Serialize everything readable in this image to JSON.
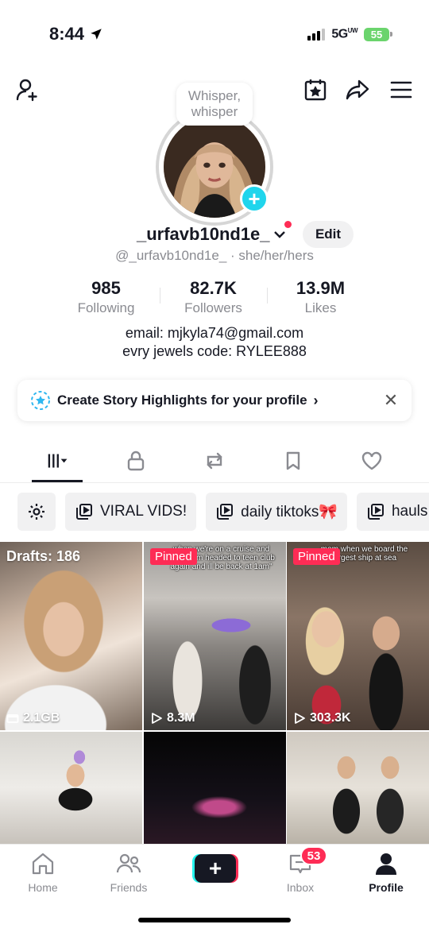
{
  "status_bar": {
    "time": "8:44",
    "network": "5G",
    "network_suffix": "UW",
    "battery": "55"
  },
  "profile": {
    "bubble_text": "Whisper, whisper",
    "username": "_urfavb10nd1e_",
    "edit_label": "Edit",
    "handle": "@_urfavb10nd1e_ · she/her/hers",
    "stats": [
      {
        "value": "985",
        "label": "Following"
      },
      {
        "value": "82.7K",
        "label": "Followers"
      },
      {
        "value": "13.9M",
        "label": "Likes"
      }
    ],
    "bio_line1": "email: mjkyla74@gmail.com",
    "bio_line2": "evry jewels code: RYLEE888"
  },
  "story_banner": {
    "text": "Create Story Highlights for your profile",
    "chevron": "›",
    "close": "✕"
  },
  "tabs": [
    {
      "icon": "videos-grid-icon",
      "active": true
    },
    {
      "icon": "lock-icon",
      "active": false
    },
    {
      "icon": "repost-icon",
      "active": false
    },
    {
      "icon": "bookmark-icon",
      "active": false
    },
    {
      "icon": "heart-icon",
      "active": false
    }
  ],
  "chips": {
    "items": [
      "VIRAL VIDS!",
      "daily tiktoks🎀",
      "hauls"
    ]
  },
  "videos": [
    {
      "overlay": "Drafts: 186",
      "stat": "2.1GB",
      "stat_icon": "folder-icon"
    },
    {
      "overlay": "Pinned",
      "caption": "when we're on a cruise and them: \"I'm headed to teen club again and ill be back at 1am\"",
      "stat": "8.3M",
      "stat_icon": "play-icon"
    },
    {
      "overlay": "Pinned",
      "caption": "mom when we board the largest ship at sea",
      "stat": "303.3K",
      "stat_icon": "play-icon"
    },
    {},
    {},
    {}
  ],
  "bottom_nav": {
    "home": "Home",
    "friends": "Friends",
    "create": "+",
    "inbox": "Inbox",
    "inbox_badge": "53",
    "profile": "Profile"
  },
  "colors": {
    "brand_red": "#fe2c55",
    "brand_cyan": "#25f4ee",
    "text": "#161823",
    "muted": "#8a8b91",
    "avatar_plus": "#20d5ec"
  }
}
